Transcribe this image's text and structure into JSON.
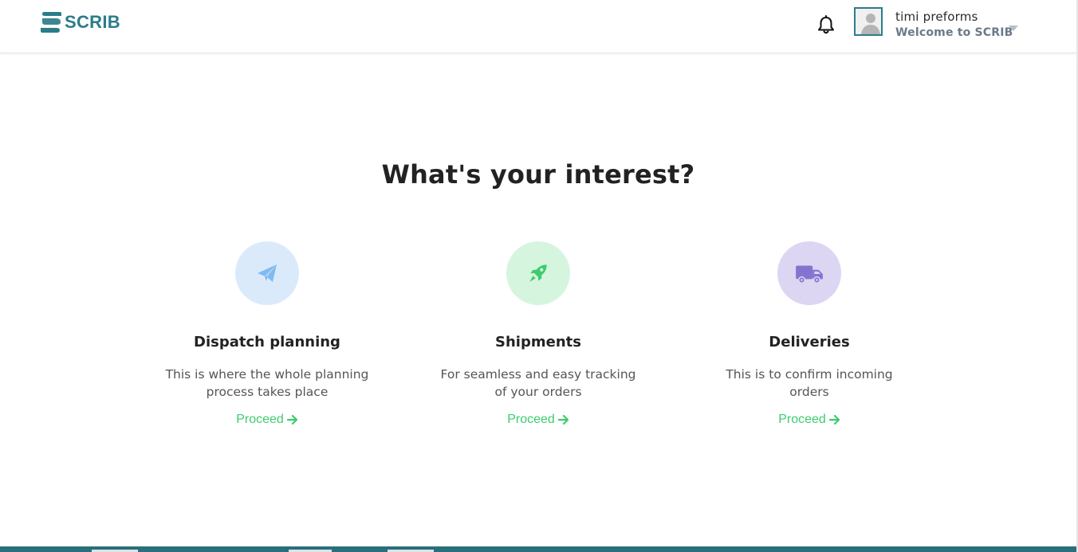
{
  "header": {
    "brand": "SCRIB",
    "user_name": "timi preforms",
    "user_subtitle": "Welcome to SCRIB"
  },
  "main": {
    "title": "What's your interest?",
    "cards": [
      {
        "title": "Dispatch planning",
        "description": "This is where the whole planning process takes place",
        "action": "Proceed",
        "icon": "paper-plane-icon",
        "icon_bg": "#dbeafb",
        "icon_color": "#7fbaf0"
      },
      {
        "title": "Shipments",
        "description": "For seamless and easy tracking of your orders",
        "action": "Proceed",
        "icon": "rocket-icon",
        "icon_bg": "#d6f5df",
        "icon_color": "#3dcc6f"
      },
      {
        "title": "Deliveries",
        "description": "This is to confirm incoming orders",
        "action": "Proceed",
        "icon": "truck-icon",
        "icon_bg": "#dcd6f3",
        "icon_color": "#8673d0"
      }
    ]
  },
  "colors": {
    "brand": "#2a7d88",
    "accent_green": "#3dcc6f",
    "footer_bar": "#2a6f7a"
  }
}
